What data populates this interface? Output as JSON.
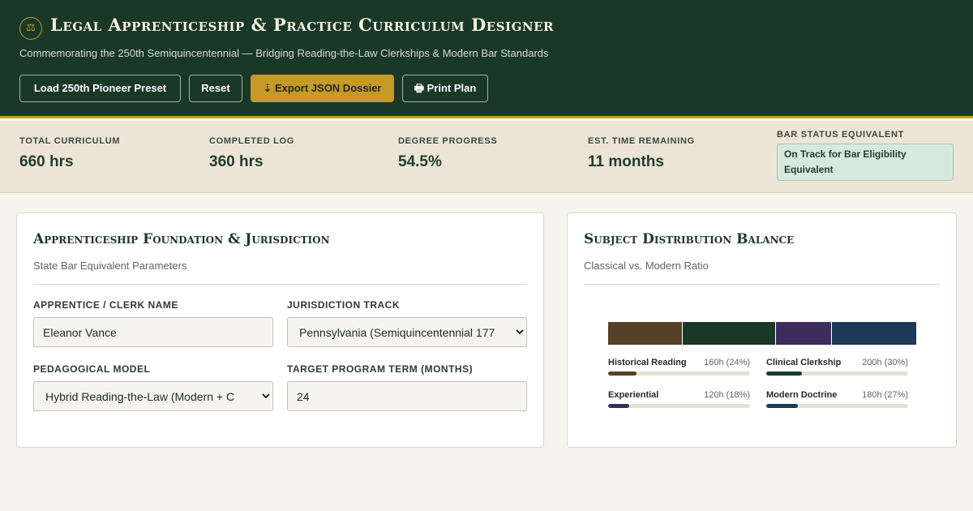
{
  "header": {
    "seal_glyph": "⚖",
    "title": "Legal Apprenticeship & Practice Curriculum Designer",
    "subtitle": "Commemorating the 250th Semiquincentennial — Bridging Reading-the-Law Clerkships & Modern Bar Standards",
    "buttons": {
      "preset": "Load 250th Pioneer Preset",
      "reset": "Reset",
      "export": "⇣ Export JSON Dossier",
      "print": "🖶 Print Plan"
    }
  },
  "stats": {
    "total_label": "Total Curriculum",
    "total_value": "660 hrs",
    "completed_label": "Completed Log",
    "completed_value": "360 hrs",
    "progress_label": "Degree Progress",
    "progress_value": "54.5%",
    "time_label": "Est. Time Remaining",
    "time_value": "11 months",
    "bar_label": "Bar Status Equivalent",
    "bar_value": "On Track for Bar Eligibility Equivalent"
  },
  "foundation": {
    "title": "Apprenticeship Foundation & Jurisdiction",
    "subtitle": "State Bar Equivalent Parameters",
    "name_label": "Apprentice / Clerk Name",
    "name_value": "Eleanor Vance",
    "jurisdiction_label": "Jurisdiction Track",
    "jurisdiction_value": "Pennsylvania (Semiquincentennial 177",
    "model_label": "Pedagogical Model",
    "model_value": "Hybrid Reading-the-Law (Modern + C",
    "term_label": "Target Program Term (Months)",
    "term_value": "24"
  },
  "distribution": {
    "title": "Subject Distribution Balance",
    "subtitle": "Classical vs. Modern Ratio",
    "subjects": [
      {
        "name": "Historical Reading",
        "hours": 160,
        "value": "160h (24%)",
        "color": "#55412a"
      },
      {
        "name": "Clinical Clerkship",
        "hours": 200,
        "value": "200h (30%)",
        "color": "#1a3828"
      },
      {
        "name": "Experiential",
        "hours": 120,
        "value": "120h (18%)",
        "color": "#3b2d5c"
      },
      {
        "name": "Modern Doctrine",
        "hours": 180,
        "value": "180h (27%)",
        "color": "#1a3a57"
      }
    ]
  },
  "colors": {
    "primary": "#1a3828",
    "accent": "#c59a27",
    "stat_band": "#ece5d6",
    "page_bg": "#f6f4ee"
  }
}
